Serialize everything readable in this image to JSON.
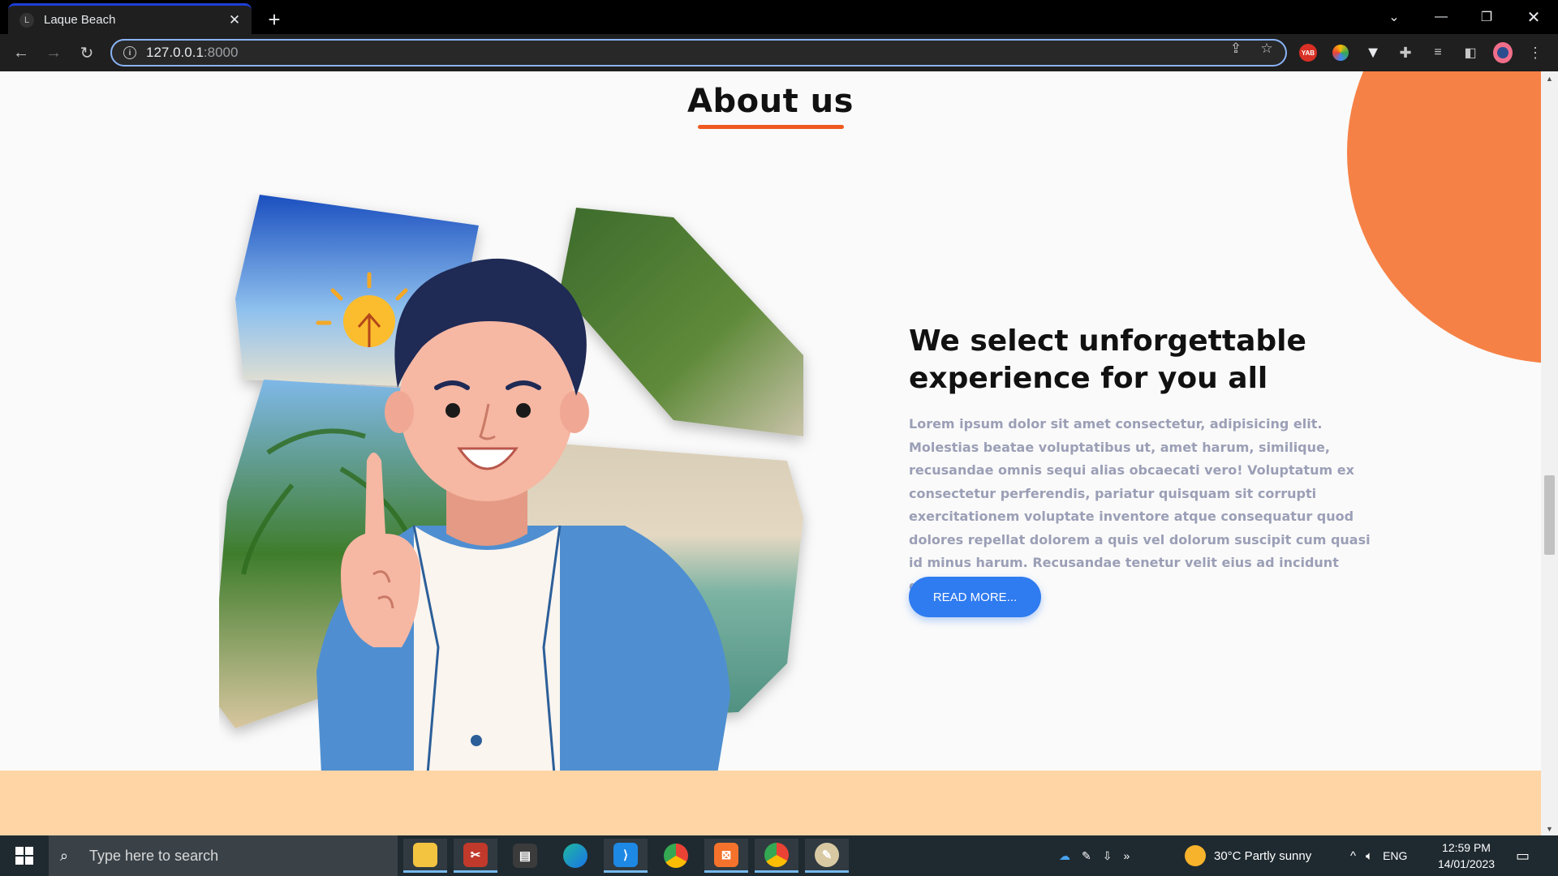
{
  "browser": {
    "tab_title": "Laque Beach",
    "favicon_letter": "L",
    "url_host": "127.0.0.1",
    "url_port": ":8000"
  },
  "page": {
    "section_title": "About us",
    "headline": "We select unforgettable experience for you all",
    "paragraph": "Lorem ipsum dolor sit amet consectetur, adipisicing elit. Molestias beatae voluptatibus ut, amet harum, similique, recusandae omnis sequi alias obcaecati vero! Voluptatum ex consectetur perferendis, pariatur quisquam sit corrupti exercitationem voluptate inventore atque consequatur quod dolores repellat dolorem a quis vel dolorum suscipit cum quasi id minus harum. Recusandae tenetur velit eius ad incidunt quibusdam.",
    "button_label": "READ MORE...",
    "accent_color": "#f68146",
    "button_color": "#2f7bf0"
  },
  "taskbar": {
    "search_placeholder": "Type here to search",
    "weather": "30°C  Partly sunny",
    "language": "ENG",
    "time": "12:59 PM",
    "date": "14/01/2023",
    "apps": [
      "file-explorer",
      "snipping-tool",
      "task-view",
      "edge",
      "vscode",
      "chrome",
      "xampp",
      "chrome-profile",
      "paint"
    ]
  }
}
